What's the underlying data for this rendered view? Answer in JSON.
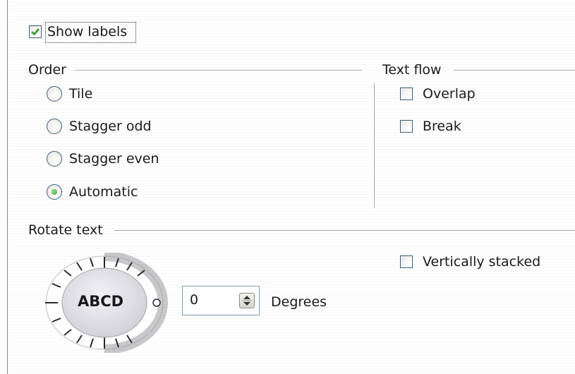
{
  "show_labels": {
    "label": "Show labels",
    "checked": true
  },
  "order": {
    "title": "Order",
    "options": [
      {
        "label": "Tile",
        "selected": false
      },
      {
        "label": "Stagger odd",
        "selected": false
      },
      {
        "label": "Stagger even",
        "selected": false
      },
      {
        "label": "Automatic",
        "selected": true
      }
    ]
  },
  "text_flow": {
    "title": "Text flow",
    "overlap": {
      "label": "Overlap",
      "checked": false
    },
    "break": {
      "label": "Break",
      "checked": false
    }
  },
  "rotate_text": {
    "title": "Rotate text",
    "dial_label": "ABCD",
    "degrees_value": "0",
    "degrees_label": "Degrees",
    "vertically_stacked": {
      "label": "Vertically stacked",
      "checked": false
    }
  },
  "colors": {
    "accent_green": "#2f9a2a",
    "border_blue": "#3c5b82",
    "group_line": "#a8a8a8"
  }
}
